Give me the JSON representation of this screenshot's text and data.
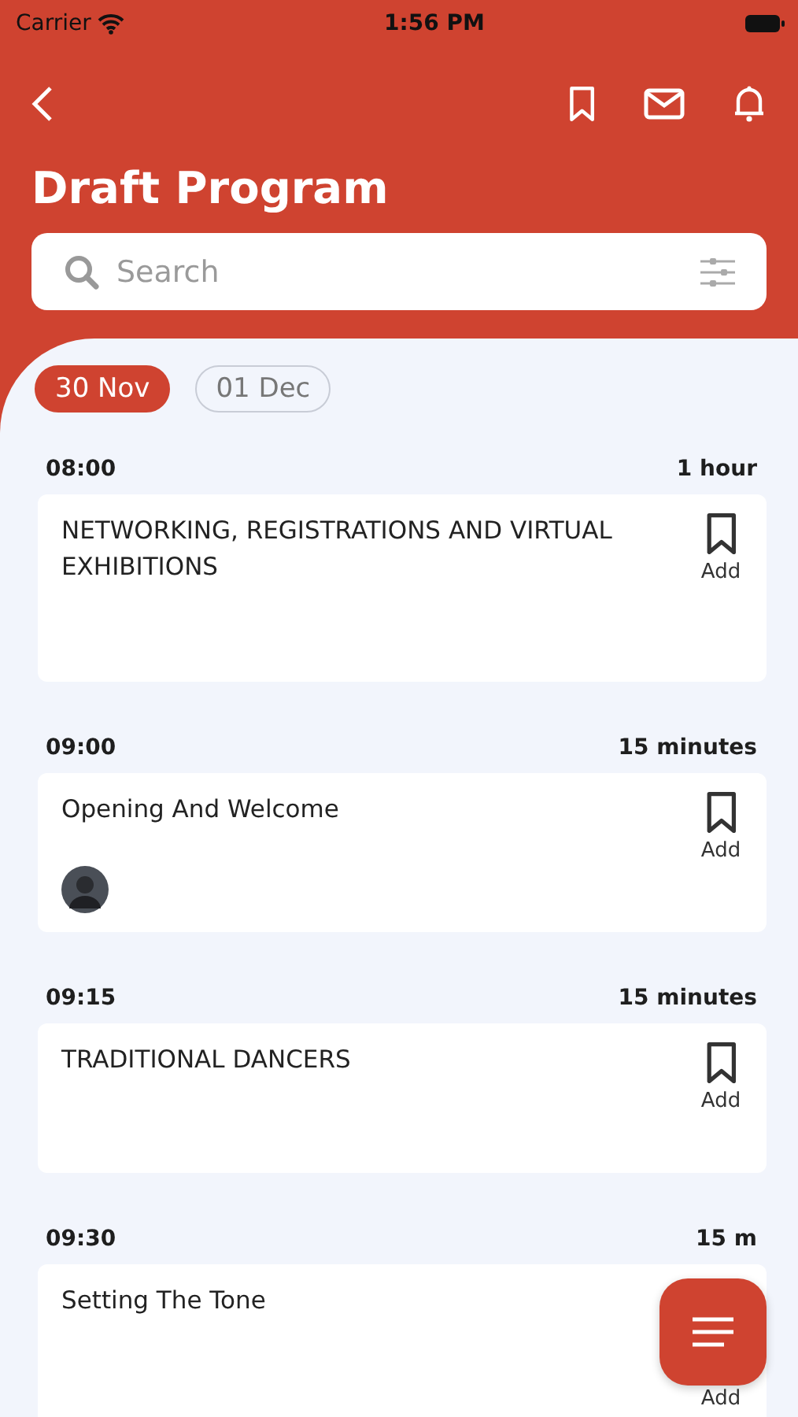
{
  "status_bar": {
    "carrier": "Carrier",
    "time": "1:56 PM"
  },
  "header": {
    "title": "Draft Program"
  },
  "search": {
    "placeholder": "Search"
  },
  "dates": [
    {
      "label": "30 Nov",
      "selected": true
    },
    {
      "label": "01 Dec",
      "selected": false
    }
  ],
  "sessions": [
    {
      "time": "08:00",
      "duration": "1 hour",
      "title": "NETWORKING, REGISTRATIONS AND VIRTUAL EXHIBITIONS",
      "add_label": "Add",
      "icon_hidden": false
    },
    {
      "time": "09:00",
      "duration": "15 minutes",
      "title": "Opening And Welcome",
      "add_label": "Add",
      "speakers": [
        {
          "kind": "avatar"
        }
      ],
      "icon_hidden": false
    },
    {
      "time": "09:15",
      "duration": "15 minutes",
      "title": "TRADITIONAL DANCERS",
      "add_label": "Add",
      "icon_hidden": false
    },
    {
      "time": "09:30",
      "duration": "15 m",
      "title": "Setting The Tone",
      "add_label": "Add",
      "icon_hidden": true
    }
  ]
}
